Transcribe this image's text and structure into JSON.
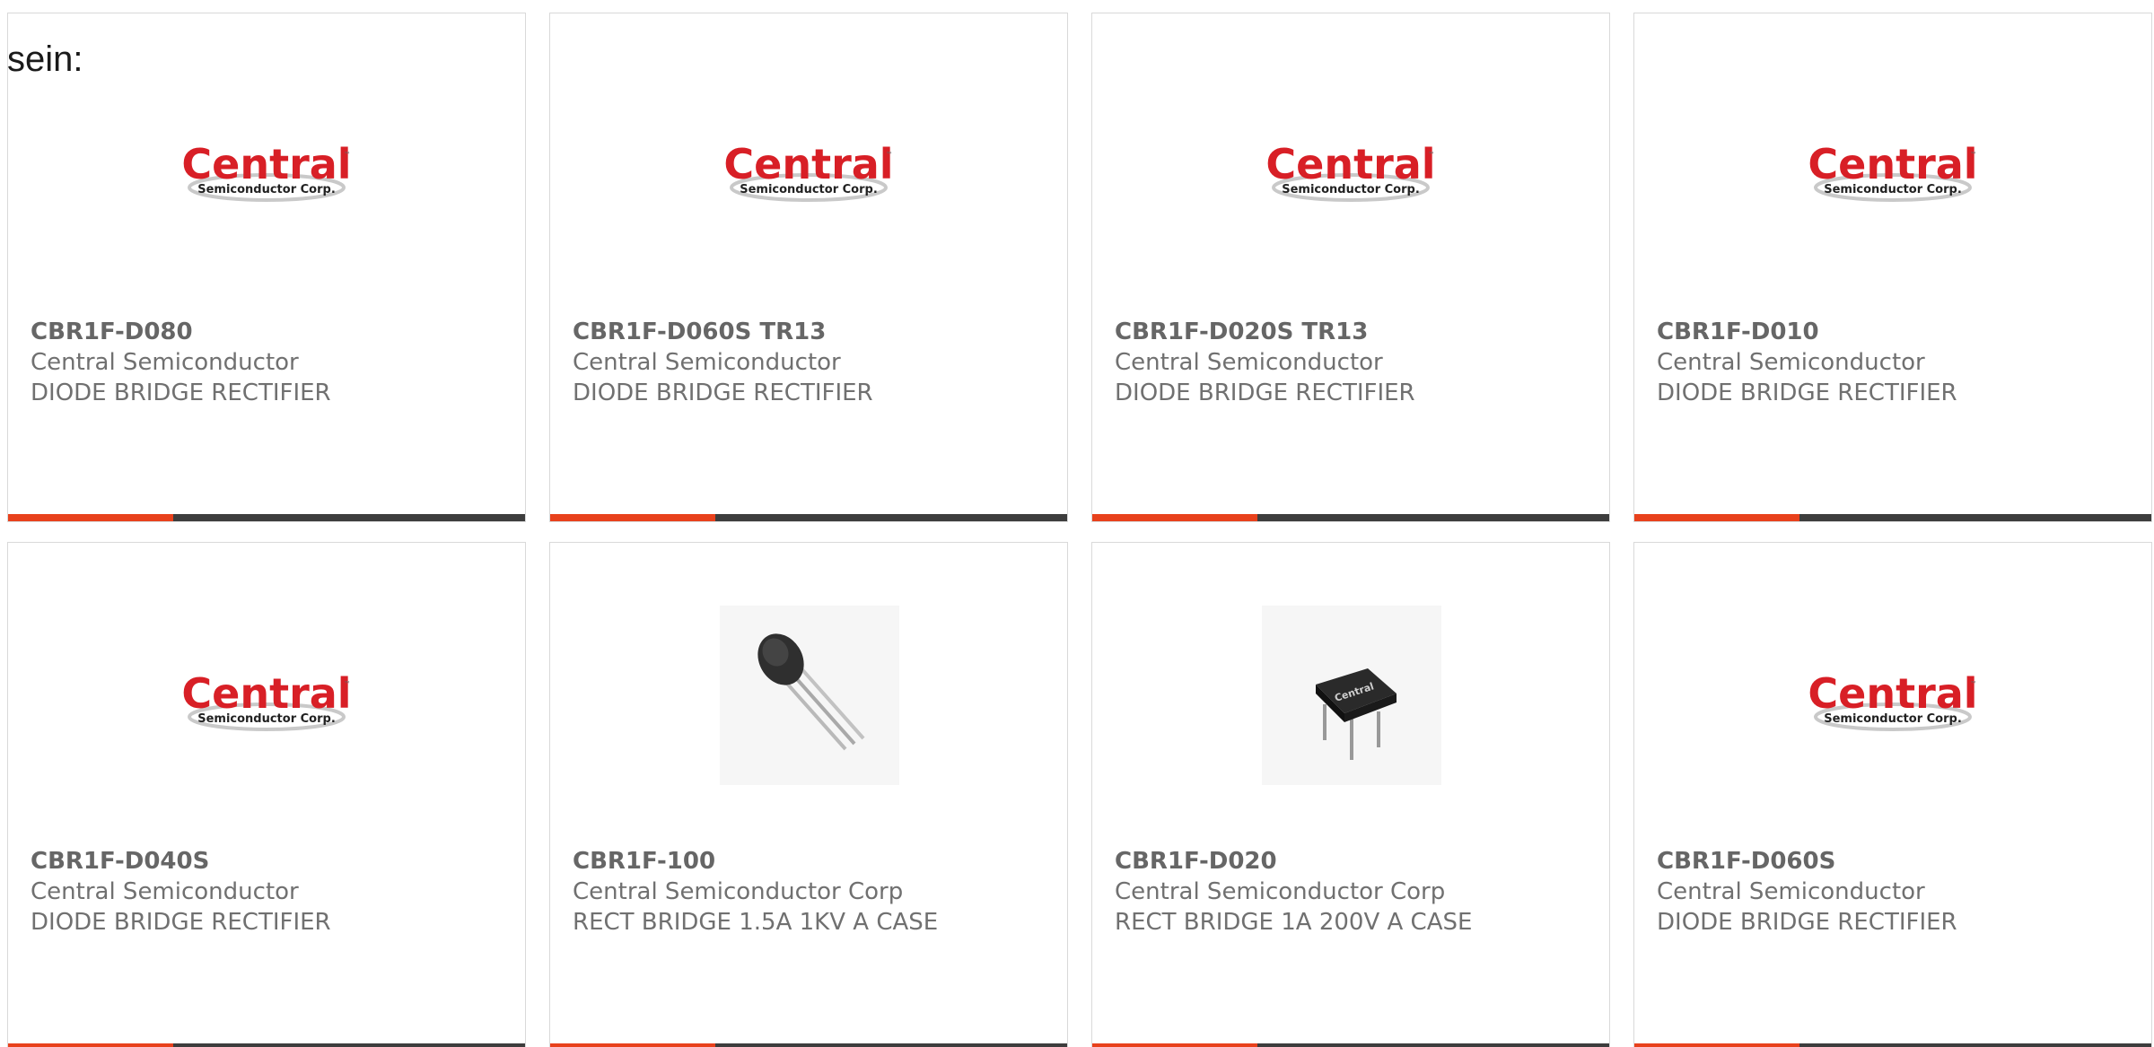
{
  "prefix_text": "sein:",
  "accent_color": "#e8411c",
  "bar_color": "#3d3d3d",
  "accent_fraction": 0.32,
  "products": [
    {
      "part": "CBR1F-D080",
      "manufacturer": "Central Semiconductor",
      "description": "DIODE BRIDGE RECTIFIER",
      "image": "central-logo"
    },
    {
      "part": "CBR1F-D060S TR13",
      "manufacturer": "Central Semiconductor",
      "description": "DIODE BRIDGE RECTIFIER",
      "image": "central-logo"
    },
    {
      "part": "CBR1F-D020S TR13",
      "manufacturer": "Central Semiconductor",
      "description": "DIODE BRIDGE RECTIFIER",
      "image": "central-logo"
    },
    {
      "part": "CBR1F-D010",
      "manufacturer": "Central Semiconductor",
      "description": "DIODE BRIDGE RECTIFIER",
      "image": "central-logo"
    },
    {
      "part": "CBR1F-D040S",
      "manufacturer": "Central Semiconductor",
      "description": "DIODE BRIDGE RECTIFIER",
      "image": "central-logo"
    },
    {
      "part": "CBR1F-100",
      "manufacturer": "Central Semiconductor Corp",
      "description": "RECT BRIDGE 1.5A 1KV A CASE",
      "image": "to92-package-photo"
    },
    {
      "part": "CBR1F-D020",
      "manufacturer": "Central Semiconductor Corp",
      "description": "RECT BRIDGE 1A 200V A CASE",
      "image": "dip-bridge-package-photo"
    },
    {
      "part": "CBR1F-D060S",
      "manufacturer": "Central Semiconductor",
      "description": "DIODE BRIDGE RECTIFIER",
      "image": "central-logo"
    }
  ],
  "logo": {
    "wordmark": "Central",
    "tagline": "Semiconductor Corp.",
    "trademark": "™",
    "color": "#d81f26"
  },
  "chip_label": "Central"
}
